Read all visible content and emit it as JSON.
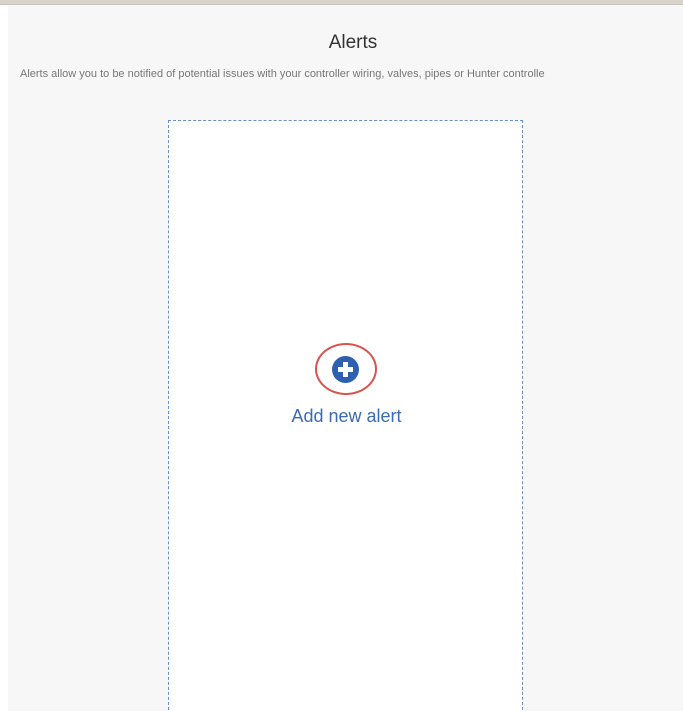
{
  "header": {
    "title": "Alerts",
    "description": "Alerts allow you to be notified of potential issues with your controller wiring, valves, pipes or Hunter controlle"
  },
  "add_card": {
    "label": "Add new alert",
    "icon": "plus-circle-icon"
  },
  "colors": {
    "accent": "#2e5fb0",
    "link_text": "#3a6bb3",
    "highlight": "#d9534f",
    "card_border": "#6b8fc4"
  }
}
